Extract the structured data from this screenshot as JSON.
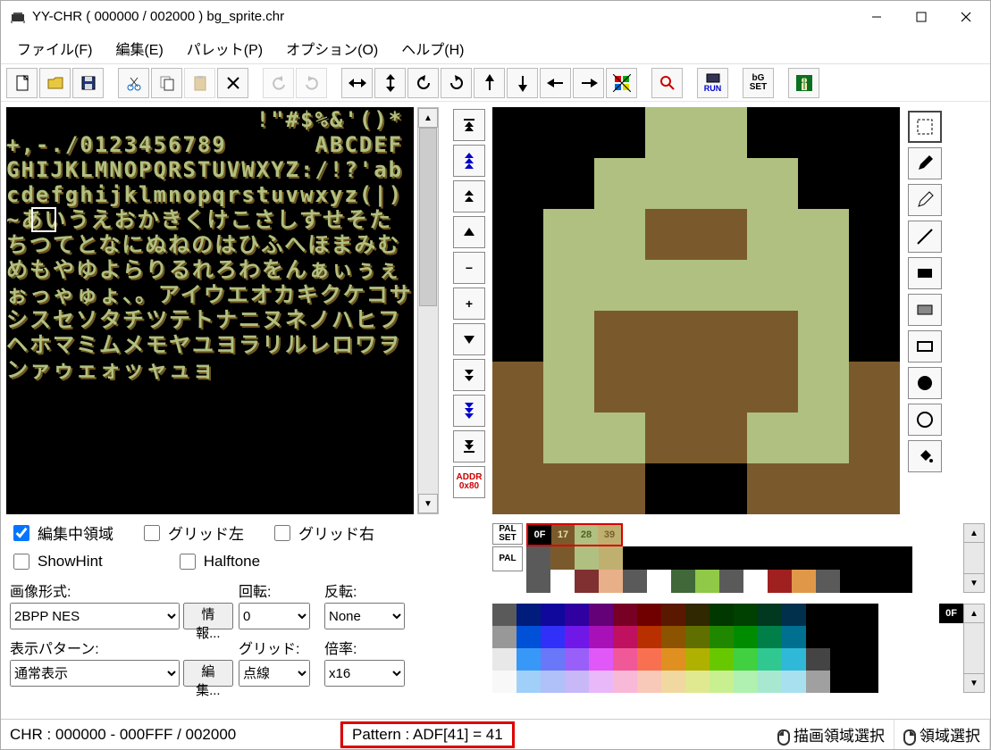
{
  "title": "YY-CHR ( 000000 / 002000 ) bg_sprite.chr",
  "menu": {
    "file": "ファイル(F)",
    "edit": "編集(E)",
    "palette": "パレット(P)",
    "option": "オプション(O)",
    "help": "ヘルプ(H)"
  },
  "toolbar": {
    "new_tip": "新規",
    "open_tip": "開く",
    "save_tip": "保存",
    "cut_tip": "切り取り",
    "copy_tip": "コピー",
    "paste_tip": "貼り付け",
    "clear_tip": "消去",
    "undo_tip": "元に戻す",
    "redo_tip": "やり直し",
    "mirror_h": "左右",
    "mirror_v": "上下",
    "rot_l": "左回転",
    "rot_r": "右回転",
    "shift_u": "上",
    "shift_d": "下",
    "shift_l": "左",
    "shift_r": "右",
    "pal_find": "パレット",
    "find": "検索",
    "run": "RUN",
    "bgset": "bG SET",
    "exit": "終了"
  },
  "chr_glyphs": "                 !\"#$%&'()*+,-./0123456789      ABCDEFGHIJKLMNOPQRSTUVWXYZ:/!?'abcdefghijklmnopqrstuvwxyz(|)~あいうえおかきくけこさしすせそたちつてとなにぬねのはひふへほまみむめもやゆよらりるれろわをんぁぃぅぇぉっゃゅょ、。アイウエオカキクケコサシスセソタチツテトナニヌネノハヒフヘホマミムメモヤユヨラリルレロワヲンァゥェォッャュョ",
  "addr_btn": {
    "l1": "ADDR",
    "l2": "0x80"
  },
  "checks": {
    "edit_area": "編集中領域",
    "grid_l": "グリッド左",
    "grid_r": "グリッド右",
    "showhint": "ShowHint",
    "halftone": "Halftone"
  },
  "opts": {
    "fmt_label": "画像形式:",
    "fmt_value": "2BPP NES",
    "info_btn": "情報...",
    "rot_label": "回転:",
    "rot_value": "0",
    "flip_label": "反転:",
    "flip_value": "None",
    "pat_label": "表示パターン:",
    "pat_value": "通常表示",
    "edit_btn": "編集...",
    "grid_label": "グリッド:",
    "grid_value": "点線",
    "zoom_label": "倍率:",
    "zoom_value": "x16"
  },
  "palset_label": "PAL\nSET",
  "pal_label": "PAL",
  "palset": [
    {
      "v": "0F",
      "bg": "#000000",
      "fg": "#ffffff"
    },
    {
      "v": "17",
      "bg": "#7a5a2c",
      "fg": "#e0e0a0"
    },
    {
      "v": "28",
      "bg": "#b0c080",
      "fg": "#506020"
    },
    {
      "v": "39",
      "bg": "#c0b070",
      "fg": "#786030"
    }
  ],
  "of_label": "0F",
  "sprite": {
    "c0": "#000000",
    "c1": "#7a5a2c",
    "c2": "#b0c080",
    "rows": [
      "00022000",
      "00222200",
      "02211220",
      "02222220",
      "02111120",
      "12111121",
      "12211221",
      "11100111"
    ]
  },
  "pal_rows": [
    [
      "#5a5a5a",
      "#7a5a2c",
      "#b0c080",
      "#c0b070",
      "#000000",
      "#000000",
      "#000000",
      "#000000",
      "#000000",
      "#000000",
      "#000000",
      "#000000",
      "#000000",
      "#000000",
      "#000000",
      "#000000"
    ],
    [
      "#5a5a5a",
      "#ffffff",
      "#803030",
      "#e8b088",
      "#5a5a5a",
      "#ffffff",
      "#406838",
      "#90c848",
      "#5a5a5a",
      "#ffffff",
      "#a02020",
      "#e09848",
      "#5a5a5a",
      "#000000",
      "#000000",
      "#000000"
    ]
  ],
  "full_pal": [
    [
      "#5a5a5a",
      "#001c7c",
      "#10089c",
      "#3000a0",
      "#640078",
      "#780024",
      "#700000",
      "#5a1800",
      "#302800",
      "#003800",
      "#004000",
      "#003820",
      "#00304c",
      "#000000",
      "#000000",
      "#000000"
    ],
    [
      "#989898",
      "#0050d8",
      "#3030f8",
      "#7018e8",
      "#a810b8",
      "#c01060",
      "#b83000",
      "#8c5400",
      "#607000",
      "#208800",
      "#008c00",
      "#008048",
      "#007090",
      "#000000",
      "#000000",
      "#000000"
    ],
    [
      "#e8e8e8",
      "#3898f8",
      "#6878f8",
      "#9860f8",
      "#e058f8",
      "#f05898",
      "#f87050",
      "#e09020",
      "#b0b000",
      "#68c800",
      "#40d040",
      "#30c890",
      "#30b8d8",
      "#444444",
      "#000000",
      "#000000"
    ],
    [
      "#f8f8f8",
      "#a0d0f8",
      "#b0c0f8",
      "#c8b8f8",
      "#e8b8f8",
      "#f8b8d8",
      "#f8c8b8",
      "#f0d8a0",
      "#e0e890",
      "#c8f090",
      "#b0f0b0",
      "#a8e8d0",
      "#a8e0f0",
      "#a0a0a0",
      "#000000",
      "#000000"
    ]
  ],
  "status": {
    "chr": "CHR : 000000 - 000FFF / 002000",
    "pattern": "Pattern : ADF[41] = 41",
    "l": "描画領域選択",
    "r": "領域選択"
  }
}
